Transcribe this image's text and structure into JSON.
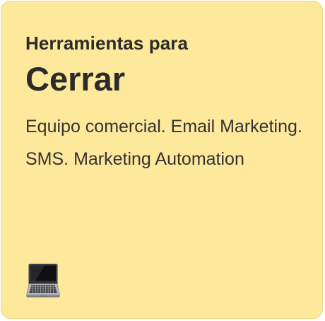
{
  "card": {
    "eyebrow": "Herramientas para",
    "title": "Cerrar",
    "description": "Equipo comercial. Email Marketing. SMS. Marketing Automation",
    "icon": "laptop-icon",
    "background_color": "#fde89b"
  }
}
